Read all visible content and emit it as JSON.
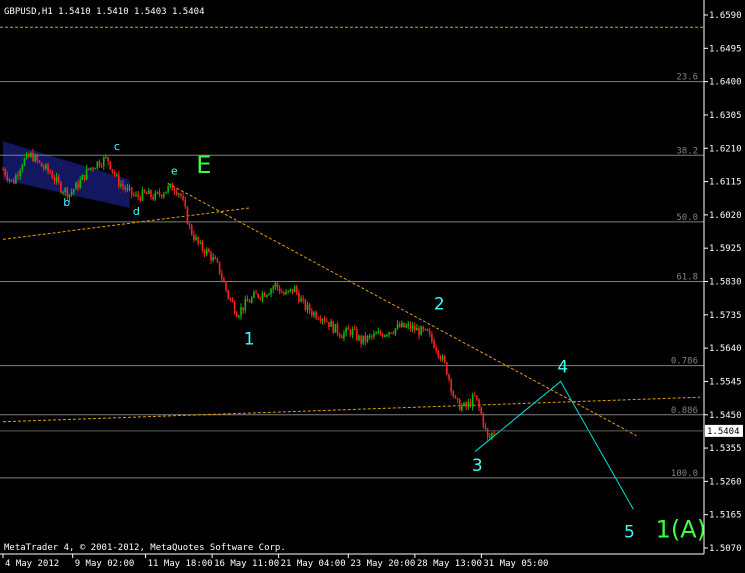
{
  "header": {
    "symbol_info": "GBPUSD,H1  1.5410 1.5410 1.5403 1.5404"
  },
  "footer": {
    "copyright": "MetaTrader 4, © 2001-2012, MetaQuotes Software Corp."
  },
  "colors": {
    "background": "#000000",
    "bull_candle": "#00c000",
    "bear_candle": "#ff2020",
    "fib_line": "#808080",
    "trend_line": "#e0a000",
    "wave_line": "#00e0e0",
    "wave_label": "#40ffff",
    "big_label": "#40ff40",
    "price_box_bg": "#ffffff",
    "price_box_fg": "#000000"
  },
  "chart_data": {
    "type": "candlestick",
    "ylim": [
      1.507,
      1.659
    ],
    "xlim": [
      0,
      22
    ],
    "y_ticks": [
      "1.6590",
      "1.6495",
      "1.6400",
      "1.6305",
      "1.6210",
      "1.6115",
      "1.6020",
      "1.5925",
      "1.5830",
      "1.5735",
      "1.5640",
      "1.5545",
      "1.5450",
      "1.5355",
      "1.5260",
      "1.5165",
      "1.5070"
    ],
    "x_ticks": [
      {
        "x": 0,
        "label": "4 May 2012"
      },
      {
        "x": 2.2,
        "label": "9 May 02:00"
      },
      {
        "x": 4.5,
        "label": "11 May 18:00"
      },
      {
        "x": 6.6,
        "label": "16 May 11:00"
      },
      {
        "x": 8.7,
        "label": "21 May 04:00"
      },
      {
        "x": 10.9,
        "label": "23 May 20:00"
      },
      {
        "x": 13.0,
        "label": "28 May 13:00"
      },
      {
        "x": 15.1,
        "label": "31 May 05:00"
      }
    ],
    "current_price": "1.5404",
    "current_price_value": 1.5404,
    "fib_levels": [
      {
        "label": "",
        "value": 1.6555
      },
      {
        "label": "23.6",
        "value": 1.64
      },
      {
        "label": "38.2",
        "value": 1.619
      },
      {
        "label": "50.0",
        "value": 1.6
      },
      {
        "label": "61.8",
        "value": 1.583
      },
      {
        "label": "0.786",
        "value": 1.559
      },
      {
        "label": "0.886",
        "value": 1.545
      },
      {
        "label": "100.0",
        "value": 1.527
      }
    ],
    "close_path": [
      [
        0.0,
        1.615
      ],
      [
        0.3,
        1.611
      ],
      [
        0.6,
        1.617
      ],
      [
        0.9,
        1.619
      ],
      [
        1.2,
        1.616
      ],
      [
        1.5,
        1.614
      ],
      [
        1.8,
        1.61
      ],
      [
        2.1,
        1.608
      ],
      [
        2.4,
        1.611
      ],
      [
        2.7,
        1.615
      ],
      [
        3.0,
        1.617
      ],
      [
        3.3,
        1.618
      ],
      [
        3.6,
        1.612
      ],
      [
        3.9,
        1.609
      ],
      [
        4.2,
        1.607
      ],
      [
        4.5,
        1.608
      ],
      [
        4.8,
        1.607
      ],
      [
        5.1,
        1.609
      ],
      [
        5.4,
        1.61
      ],
      [
        5.6,
        1.608
      ],
      [
        5.9,
        1.598
      ],
      [
        6.2,
        1.593
      ],
      [
        6.5,
        1.591
      ],
      [
        6.8,
        1.587
      ],
      [
        7.1,
        1.579
      ],
      [
        7.4,
        1.574
      ],
      [
        7.7,
        1.577
      ],
      [
        8.0,
        1.579
      ],
      [
        8.3,
        1.58
      ],
      [
        8.6,
        1.582
      ],
      [
        8.9,
        1.579
      ],
      [
        9.2,
        1.581
      ],
      [
        9.5,
        1.576
      ],
      [
        9.8,
        1.574
      ],
      [
        10.1,
        1.573
      ],
      [
        10.4,
        1.57
      ],
      [
        10.7,
        1.568
      ],
      [
        11.0,
        1.569
      ],
      [
        11.3,
        1.566
      ],
      [
        11.6,
        1.567
      ],
      [
        11.9,
        1.568
      ],
      [
        12.2,
        1.569
      ],
      [
        12.5,
        1.57
      ],
      [
        12.8,
        1.57
      ],
      [
        13.1,
        1.569
      ],
      [
        13.4,
        1.568
      ],
      [
        13.7,
        1.564
      ],
      [
        14.0,
        1.558
      ],
      [
        14.3,
        1.548
      ],
      [
        14.6,
        1.547
      ],
      [
        14.9,
        1.55
      ],
      [
        15.1,
        1.545
      ],
      [
        15.3,
        1.538
      ],
      [
        15.5,
        1.5404
      ]
    ],
    "shaded_zone": [
      [
        0.0,
        1.623
      ],
      [
        4.0,
        1.612
      ],
      [
        4.0,
        1.604
      ],
      [
        0.0,
        1.612
      ]
    ],
    "trend_lines": [
      {
        "from": [
          5.2,
          1.611
        ],
        "to": [
          20.0,
          1.539
        ]
      },
      {
        "from": [
          0.0,
          1.595
        ],
        "to": [
          7.8,
          1.604
        ]
      },
      {
        "from": [
          0.0,
          1.543
        ],
        "to": [
          22.0,
          1.55
        ]
      }
    ],
    "wave_path": [
      [
        14.9,
        1.5345
      ],
      [
        17.6,
        1.5545
      ],
      [
        19.9,
        1.518
      ]
    ],
    "wave_labels": [
      {
        "text": "c",
        "x": 3.5,
        "y": 1.6205,
        "size": 11
      },
      {
        "text": "b",
        "x": 1.9,
        "y": 1.6045,
        "size": 11
      },
      {
        "text": "d",
        "x": 4.1,
        "y": 1.602,
        "size": 11
      },
      {
        "text": "e",
        "x": 5.3,
        "y": 1.6135,
        "size": 11
      },
      {
        "text": "E",
        "x": 6.1,
        "y": 1.614,
        "size": 24,
        "big": true
      },
      {
        "text": "1",
        "x": 7.6,
        "y": 1.565,
        "size": 17
      },
      {
        "text": "2",
        "x": 13.6,
        "y": 1.575,
        "size": 17
      },
      {
        "text": "3",
        "x": 14.8,
        "y": 1.529,
        "size": 17
      },
      {
        "text": "4",
        "x": 17.5,
        "y": 1.557,
        "size": 17
      },
      {
        "text": "5",
        "x": 19.6,
        "y": 1.51,
        "size": 17
      },
      {
        "text": "1(A)",
        "x": 20.6,
        "y": 1.51,
        "size": 24,
        "big": true
      }
    ]
  }
}
